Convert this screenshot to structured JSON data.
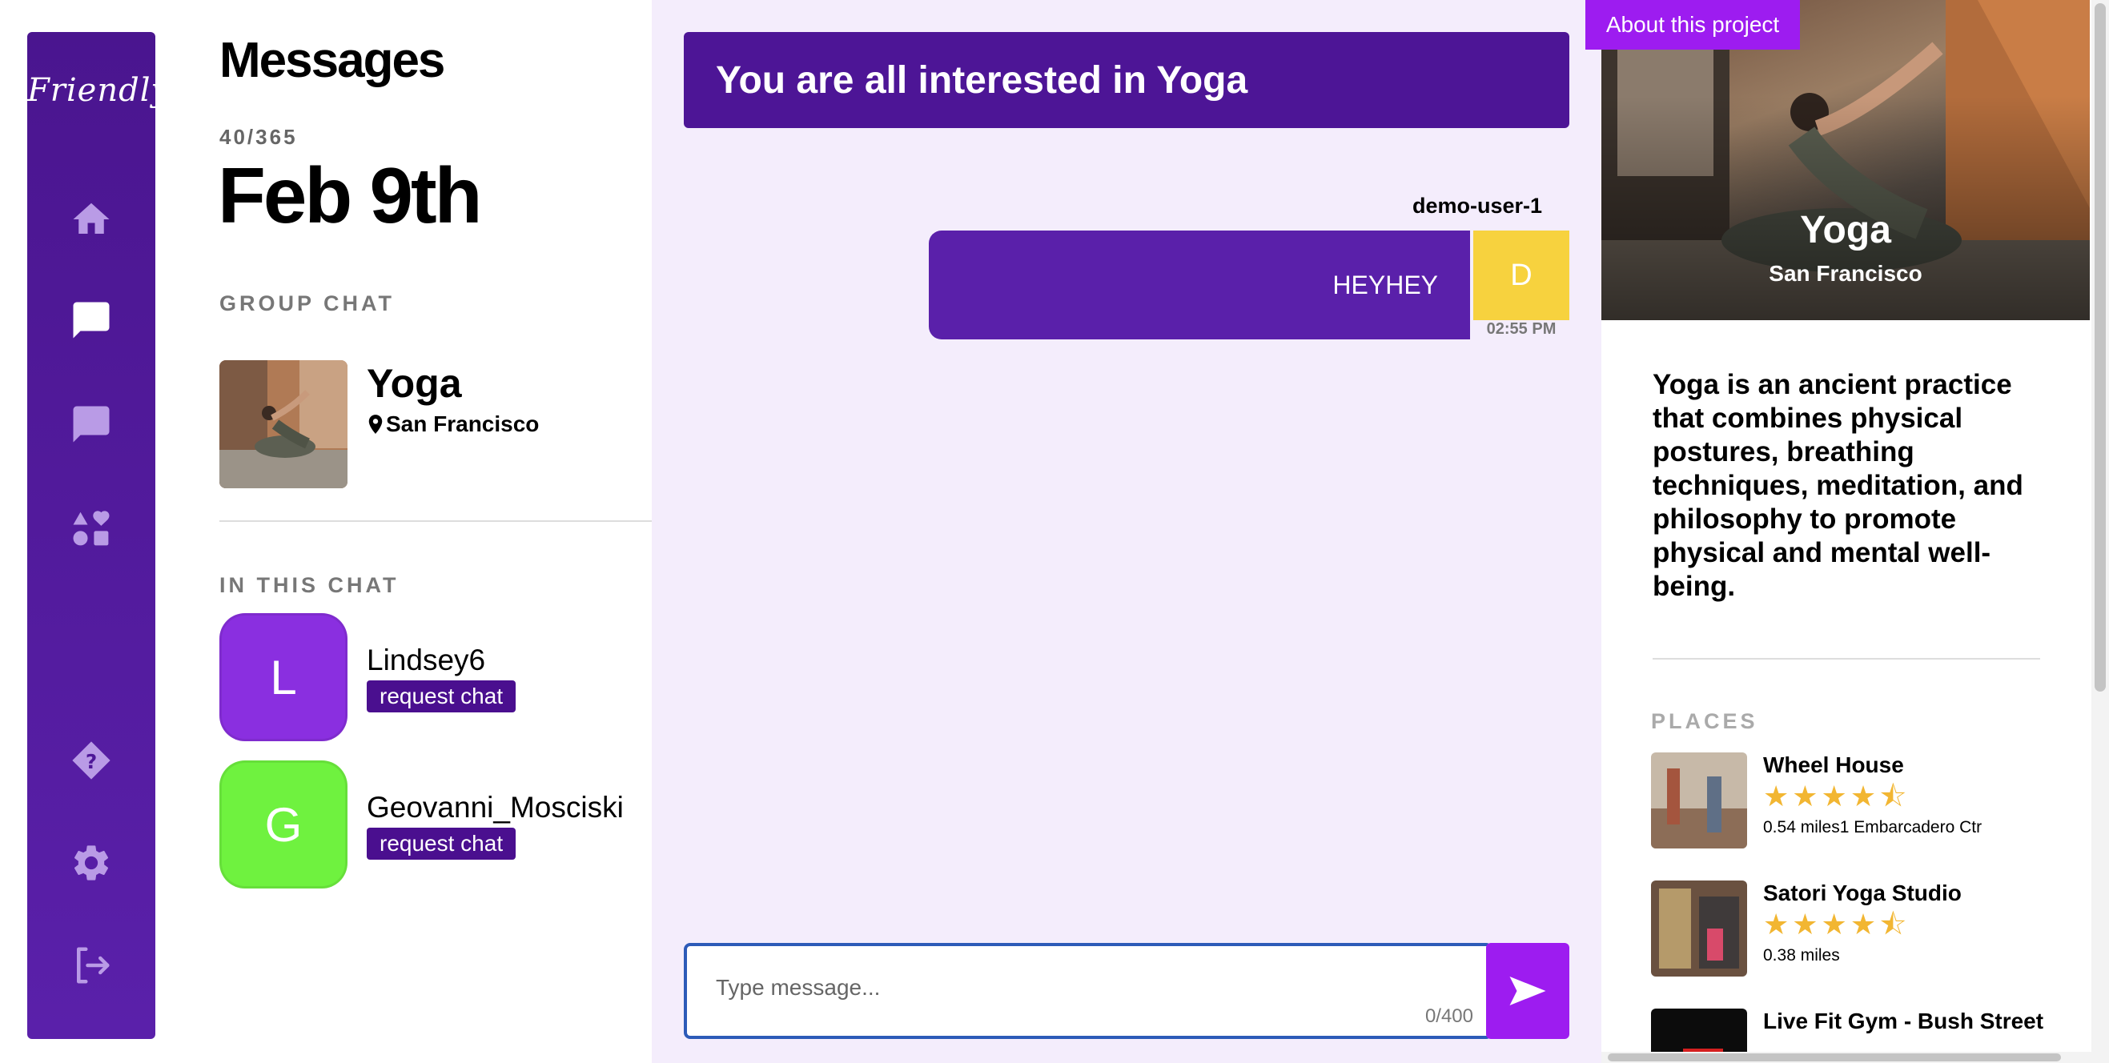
{
  "nav": {
    "logo": "Friendly",
    "items": [
      "home-icon",
      "chat-icon",
      "chat-outline-icon",
      "interests-icon",
      "help-icon",
      "settings-icon",
      "logout-icon"
    ]
  },
  "info": {
    "heading": "Messages",
    "day_counter": "40/365",
    "date": "Feb 9th",
    "group_label": "GROUP CHAT",
    "group": {
      "name": "Yoga",
      "location": "San Francisco"
    },
    "members_label": "IN THIS CHAT",
    "members": [
      {
        "initial": "L",
        "name": "Lindsey6",
        "action": "request chat",
        "color": "#8a2fe0"
      },
      {
        "initial": "G",
        "name": "Geovanni_Mosciski",
        "action": "request chat",
        "color": "#6ff23f"
      }
    ]
  },
  "chat": {
    "banner": "You are all interested in Yoga",
    "messages": [
      {
        "user": "demo-user-1",
        "text": "HEYHEY",
        "initial": "D",
        "time": "02:55 PM"
      }
    ],
    "placeholder": "Type message...",
    "char_count": "0/400"
  },
  "about": {
    "button": "About this project",
    "title": "Yoga",
    "subtitle": "San Francisco",
    "description": "Yoga is an ancient practice that combines physical postures, breathing techniques, meditation, and philosophy to promote physical and mental well-being.",
    "places_label": "PLACES",
    "places": [
      {
        "name": "Wheel House",
        "stars": "★★★★⯪",
        "rating": 4.5,
        "meta": "0.54 miles1 Embarcadero Ctr"
      },
      {
        "name": "Satori Yoga Studio",
        "stars": "★★★★⯪",
        "rating": 4.5,
        "meta": "0.38 miles"
      },
      {
        "name": "Live Fit Gym - Bush Street",
        "stars": "",
        "meta": ""
      }
    ]
  },
  "colors": {
    "primary": "#4d1596",
    "accent": "#9d1cf0",
    "chat_bg": "#f4edfc",
    "avatar_d": "#f7d23e"
  }
}
